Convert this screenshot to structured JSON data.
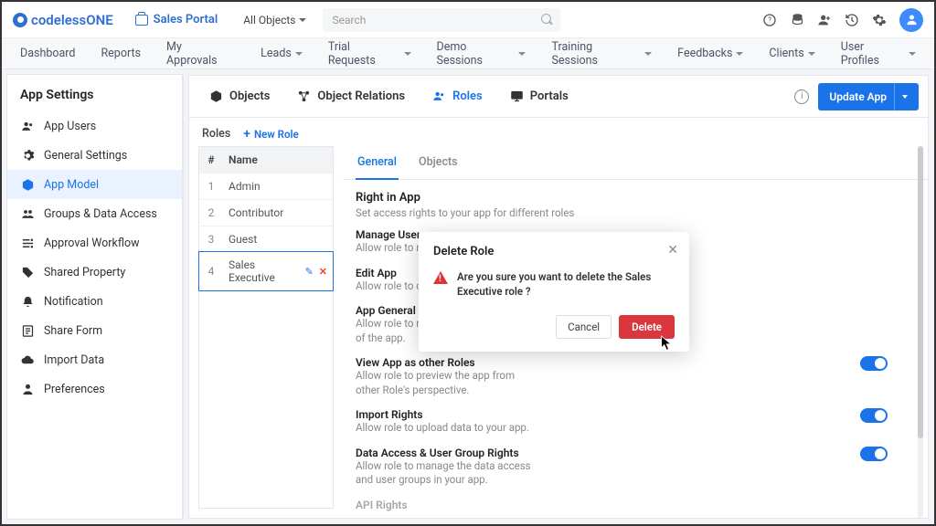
{
  "brand": {
    "name": "codeless",
    "suffix": "ONE"
  },
  "portal": {
    "label": "Sales Portal"
  },
  "objectSelector": {
    "label": "All Objects"
  },
  "search": {
    "placeholder": "Search"
  },
  "nav": {
    "items": [
      {
        "label": "Dashboard"
      },
      {
        "label": "Reports"
      },
      {
        "label": "My Approvals"
      },
      {
        "label": "Leads",
        "dd": true
      },
      {
        "label": "Trial Requests",
        "dd": true
      },
      {
        "label": "Demo Sessions",
        "dd": true
      },
      {
        "label": "Training Sessions",
        "dd": true
      },
      {
        "label": "Feedbacks",
        "dd": true
      },
      {
        "label": "Clients",
        "dd": true
      },
      {
        "label": "User Profiles",
        "dd": true
      }
    ]
  },
  "sidebar": {
    "title": "App Settings",
    "items": [
      {
        "label": "App Users"
      },
      {
        "label": "General Settings"
      },
      {
        "label": "App Model"
      },
      {
        "label": "Groups & Data Access"
      },
      {
        "label": "Approval Workflow"
      },
      {
        "label": "Shared Property"
      },
      {
        "label": "Notification"
      },
      {
        "label": "Share Form"
      },
      {
        "label": "Import Data"
      },
      {
        "label": "Preferences"
      }
    ]
  },
  "contentTabs": {
    "items": [
      {
        "label": "Objects"
      },
      {
        "label": "Object Relations"
      },
      {
        "label": "Roles"
      },
      {
        "label": "Portals"
      }
    ],
    "updateBtn": "Update App"
  },
  "crumb": {
    "label": "Roles",
    "newRole": "New Role"
  },
  "rolesTable": {
    "head": {
      "num": "#",
      "name": "Name"
    },
    "rows": [
      {
        "n": "1",
        "name": "Admin"
      },
      {
        "n": "2",
        "name": "Contributor"
      },
      {
        "n": "3",
        "name": "Guest"
      },
      {
        "n": "4",
        "name": "Sales Executive"
      }
    ]
  },
  "detailTabs": {
    "general": "General",
    "objects": "Objects"
  },
  "rightInApp": {
    "title": "Right in App",
    "sub": "Set access rights to your app for different roles"
  },
  "perms": [
    {
      "title": "Manage User",
      "desc": "Allow role to m"
    },
    {
      "title": "Edit App",
      "desc": "Allow role to c"
    },
    {
      "title": "App General S",
      "desc": "Allow role to m\nof the app."
    },
    {
      "title": "View App as other Roles",
      "desc": "Allow role to preview the app from other Role's perspective."
    },
    {
      "title": "Import Rights",
      "desc": "Allow role to upload data to your app."
    },
    {
      "title": "Data Access & User Group Rights",
      "desc": "Allow role to manage the data access and user groups in your app."
    },
    {
      "title": "API Rights",
      "desc": ""
    }
  ],
  "modal": {
    "title": "Delete Role",
    "message": "Are you sure you want to delete the Sales Executive role ?",
    "cancel": "Cancel",
    "delete": "Delete"
  }
}
